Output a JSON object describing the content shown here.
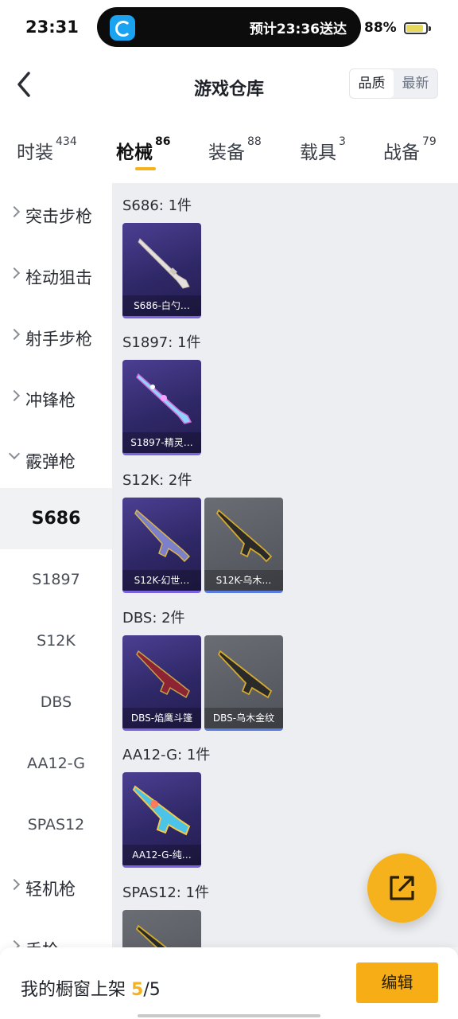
{
  "status_bar": {
    "time": "23:31",
    "island_text": "预计23:36送达",
    "battery_percent": "88%",
    "battery_level": 0.88
  },
  "header": {
    "title": "游戏仓库",
    "sort_options": [
      "品质",
      "最新"
    ],
    "active_sort": "品质"
  },
  "tabs": [
    {
      "label": "时装",
      "count": "434"
    },
    {
      "label": "枪械",
      "count": "86"
    },
    {
      "label": "装备",
      "count": "88"
    },
    {
      "label": "载具",
      "count": "3"
    },
    {
      "label": "战备",
      "count": "79"
    }
  ],
  "active_tab": "枪械",
  "sidebar": {
    "categories": [
      {
        "label": "突击步枪",
        "expanded": false
      },
      {
        "label": "栓动狙击",
        "expanded": false
      },
      {
        "label": "射手步枪",
        "expanded": false
      },
      {
        "label": "冲锋枪",
        "expanded": false
      },
      {
        "label": "霰弹枪",
        "expanded": true
      },
      {
        "label": "轻机枪",
        "expanded": false
      },
      {
        "label": "手枪",
        "expanded": false
      }
    ],
    "sub_items": [
      "S686",
      "S1897",
      "S12K",
      "DBS",
      "AA12-G",
      "SPAS12"
    ],
    "selected_sub": "S686"
  },
  "groups": [
    {
      "title": "S686: 1件",
      "items": [
        {
          "name": "S686-白勺…",
          "rarity": "purple"
        }
      ]
    },
    {
      "title": "S1897: 1件",
      "items": [
        {
          "name": "S1897-精灵…",
          "rarity": "purple"
        }
      ]
    },
    {
      "title": "S12K: 2件",
      "items": [
        {
          "name": "S12K-幻世…",
          "rarity": "purple"
        },
        {
          "name": "S12K-乌木…",
          "rarity": "gray"
        }
      ]
    },
    {
      "title": "DBS: 2件",
      "items": [
        {
          "name": "DBS-焰鹰斗篷",
          "rarity": "purple"
        },
        {
          "name": "DBS-乌木金纹",
          "rarity": "gray"
        }
      ]
    },
    {
      "title": "AA12-G: 1件",
      "items": [
        {
          "name": "AA12-G-纯…",
          "rarity": "purple"
        }
      ]
    },
    {
      "title": "SPAS12: 1件",
      "items": [
        {
          "name": "",
          "rarity": "gray"
        }
      ]
    }
  ],
  "bottom_bar": {
    "shelf_label": "我的橱窗上架",
    "shelf_current": "5",
    "shelf_total": "/5",
    "edit_label": "编辑"
  },
  "icons": {
    "back": "chevron-left-icon",
    "fab": "share-export-icon",
    "app": "eleme-app-icon"
  },
  "colors": {
    "accent": "#f7b21a",
    "purple_rarity": "#2f2867",
    "gray_rarity": "#55585e"
  }
}
